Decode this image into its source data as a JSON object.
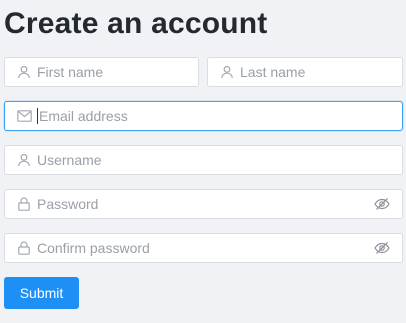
{
  "form": {
    "title": "Create an account",
    "first_name": {
      "placeholder": "First name",
      "value": ""
    },
    "last_name": {
      "placeholder": "Last name",
      "value": ""
    },
    "email": {
      "placeholder": "Email address",
      "value": ""
    },
    "username": {
      "placeholder": "Username",
      "value": ""
    },
    "password": {
      "placeholder": "Password",
      "value": ""
    },
    "confirm_password": {
      "placeholder": "Confirm password",
      "value": ""
    },
    "submit_label": "Submit"
  },
  "icons": {
    "first_name": "user-icon",
    "last_name": "user-icon",
    "email": "mail-icon",
    "username": "user-icon",
    "password": "lock-icon",
    "confirm_password": "lock-icon",
    "password_toggle": "eye-off-icon",
    "confirm_password_toggle": "eye-off-icon"
  },
  "colors": {
    "accent": "#1e90f5",
    "focus_border": "#3aa0f3",
    "background": "#f1f2f5"
  }
}
